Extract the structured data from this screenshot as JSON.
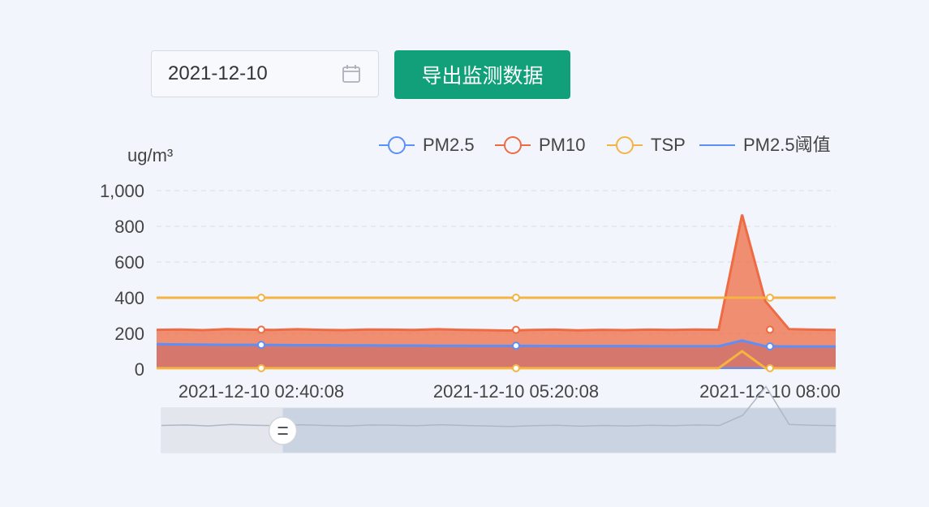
{
  "toolbar": {
    "date_value": "2021-12-10",
    "calendar_icon": "calendar-icon",
    "export_label": "导出监测数据",
    "export_color": "#11a07a"
  },
  "chart_data": {
    "type": "line",
    "ylabel": "ug/m³",
    "ylim": [
      0,
      1000
    ],
    "y_ticks": [
      "0",
      "200",
      "400",
      "600",
      "800",
      "1,000"
    ],
    "x_ticks": [
      "2021-12-10 02:40:08",
      "2021-12-10 05:20:08",
      "2021-12-10 08:00"
    ],
    "grid": true,
    "legend_position": "top",
    "series": [
      {
        "name": "PM2.5",
        "color": "#5b8ff9",
        "area": false,
        "values": [
          140,
          138,
          137,
          136,
          136,
          135,
          134,
          134,
          133,
          133,
          132,
          132,
          131,
          131,
          130,
          130,
          130,
          129,
          129,
          129,
          129,
          128,
          128,
          128,
          128,
          160,
          128,
          127,
          127,
          127
        ]
      },
      {
        "name": "PM10",
        "color": "#ee6b43",
        "area": true,
        "values": [
          220,
          222,
          218,
          224,
          221,
          219,
          223,
          220,
          218,
          222,
          221,
          219,
          223,
          220,
          218,
          216,
          219,
          221,
          217,
          220,
          218,
          221,
          219,
          222,
          220,
          865,
          380,
          224,
          221,
          219
        ]
      },
      {
        "name": "TSP",
        "color": "#f5b342",
        "area": false,
        "values": [
          400,
          400,
          400,
          400,
          400,
          400,
          400,
          400,
          400,
          400,
          400,
          400,
          400,
          400,
          400,
          400,
          400,
          400,
          400,
          400,
          400,
          400,
          400,
          400,
          400,
          400,
          400,
          400,
          400,
          400
        ]
      },
      {
        "name": "PM2.5阈值",
        "color": "#5b8ff9",
        "area": false,
        "values": [
          5,
          5,
          5,
          5,
          5,
          5,
          5,
          5,
          5,
          5,
          5,
          5,
          5,
          5,
          5,
          5,
          5,
          5,
          5,
          5,
          5,
          5,
          5,
          5,
          5,
          5,
          5,
          5,
          5,
          5
        ]
      }
    ],
    "tsp_low": {
      "color": "#f5b342",
      "values": [
        5,
        5,
        5,
        5,
        5,
        5,
        5,
        5,
        5,
        5,
        5,
        5,
        5,
        5,
        5,
        5,
        5,
        5,
        5,
        5,
        5,
        5,
        5,
        5,
        5,
        100,
        5,
        5,
        5,
        5
      ]
    },
    "zoom": {
      "start": 0,
      "end": 0.18
    }
  }
}
